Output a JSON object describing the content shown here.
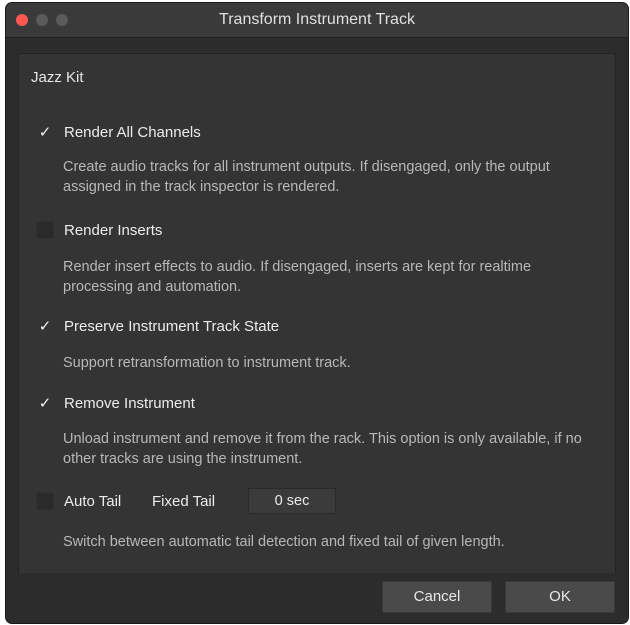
{
  "window": {
    "title": "Transform Instrument Track"
  },
  "kit_name": "Jazz Kit",
  "options": [
    {
      "label": "Render All Channels",
      "checked": true,
      "description": "Create audio tracks for all instrument outputs. If disengaged, only the output assigned in the track inspector is rendered."
    },
    {
      "label": "Render Inserts",
      "checked": false,
      "description": "Render insert effects to audio. If disengaged, inserts are kept for realtime processing and automation."
    },
    {
      "label": "Preserve Instrument Track State",
      "checked": true,
      "description": "Support retransformation to instrument track."
    },
    {
      "label": "Remove Instrument",
      "checked": true,
      "description": "Unload instrument and remove it from the rack. This option is only available, if no other tracks are using the instrument."
    },
    {
      "label": "Auto Tail",
      "checked": false,
      "description": "Switch between automatic tail detection and fixed tail of given length."
    }
  ],
  "fixed_tail": {
    "label": "Fixed Tail",
    "value": "0 sec"
  },
  "buttons": {
    "cancel": "Cancel",
    "ok": "OK"
  },
  "checkmark_glyph": "✓"
}
